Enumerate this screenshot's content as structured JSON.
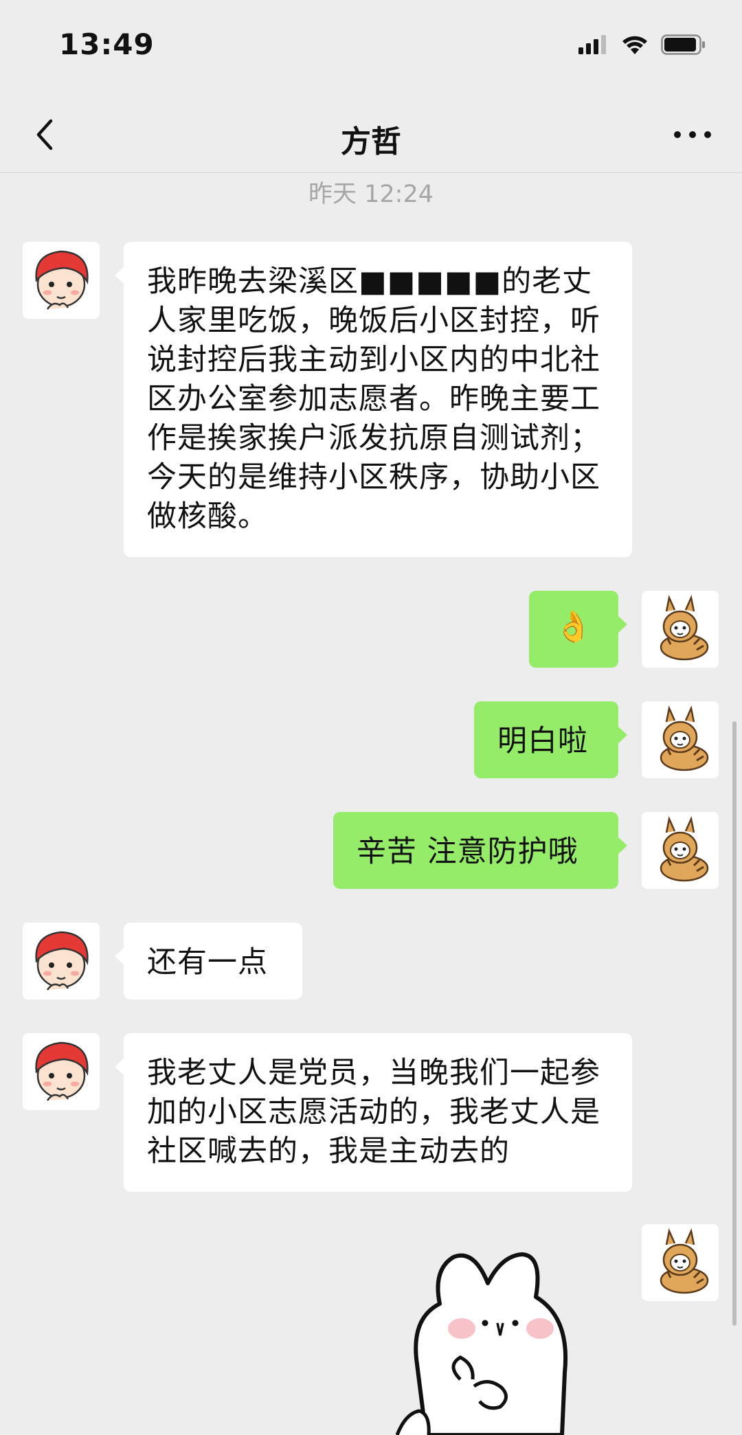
{
  "status_bar": {
    "time": "13:49"
  },
  "nav": {
    "title": "方哲",
    "back_icon": "chevron-left-icon",
    "more_icon": "ellipsis-icon"
  },
  "chat": {
    "timestamp": "昨天 12:24",
    "messages": [
      {
        "side": "left",
        "text": "我昨晚去梁溪区■■■■■的老丈人家里吃饭，晚饭后小区封控，听说封控后我主动到小区内的中北社区办公室参加志愿者。昨晚主要工作是挨家挨户派发抗原自测试剂；今天的是维持小区秩序，协助小区做核酸。"
      },
      {
        "side": "right",
        "text": "👌"
      },
      {
        "side": "right",
        "text": "明白啦"
      },
      {
        "side": "right",
        "text": "辛苦 注意防护哦"
      },
      {
        "side": "left",
        "text": "还有一点"
      },
      {
        "side": "left",
        "text": "我老丈人是党员，当晚我们一起参加的小区志愿活动的，我老丈人是社区喊去的，我是主动去的"
      },
      {
        "side": "right",
        "type": "sticker",
        "sticker": "white-bunny-sticker"
      }
    ]
  },
  "colors": {
    "background": "#ededed",
    "self_bubble": "#95ec69",
    "other_bubble": "#ffffff"
  }
}
